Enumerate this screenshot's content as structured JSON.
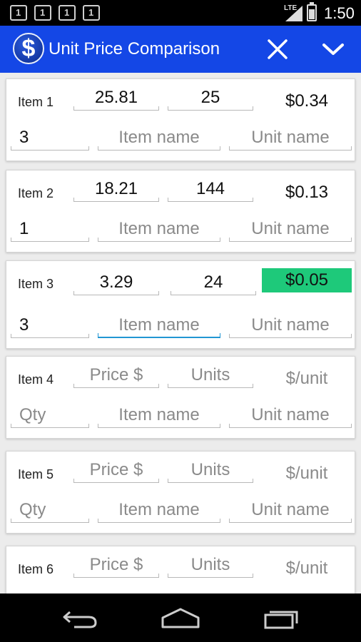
{
  "status": {
    "time": "1:50",
    "network": "LTE",
    "notifications": [
      "1",
      "1",
      "1",
      "1"
    ]
  },
  "app": {
    "title": "Unit Price Comparison",
    "logo_glyph": "$",
    "accent": "#1447e6",
    "best_color": "#1ec97a"
  },
  "items": [
    {
      "label": "Item 1",
      "price": "25.81",
      "units": "25",
      "unit_price": "$0.34",
      "qty": "3",
      "name": "",
      "unit_name": ""
    },
    {
      "label": "Item 2",
      "price": "18.21",
      "units": "144",
      "unit_price": "$0.13",
      "qty": "1",
      "name": "",
      "unit_name": ""
    },
    {
      "label": "Item 3",
      "price": "3.29",
      "units": "24",
      "unit_price": "$0.05",
      "qty": "3",
      "name": "",
      "unit_name": "",
      "best": true,
      "focused": "name"
    },
    {
      "label": "Item 4",
      "price": "",
      "units": "",
      "unit_price": "",
      "qty": "",
      "name": "",
      "unit_name": ""
    },
    {
      "label": "Item 5",
      "price": "",
      "units": "",
      "unit_price": "",
      "qty": "",
      "name": "",
      "unit_name": ""
    },
    {
      "label": "Item 6",
      "price": "",
      "units": "",
      "unit_price": "",
      "qty": "",
      "name": "",
      "unit_name": ""
    }
  ],
  "placeholders": {
    "price": "Price $",
    "units": "Units",
    "unit_price": "$/unit",
    "qty": "Qty",
    "name": "Item name",
    "unit_name": "Unit name"
  },
  "icons": {
    "close": "close-icon",
    "menu": "chevron-down-icon",
    "back": "back-icon",
    "home": "home-icon",
    "recents": "recent-apps-icon"
  }
}
